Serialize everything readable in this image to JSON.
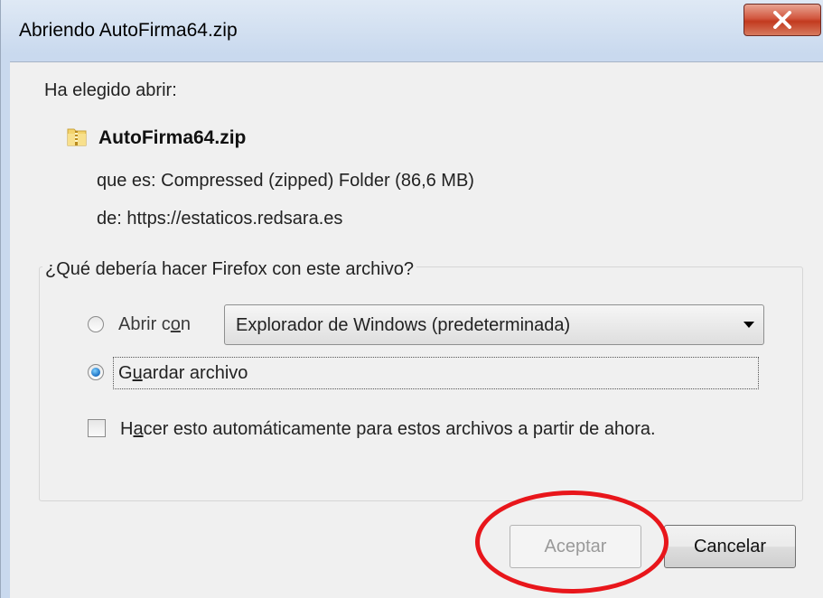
{
  "window": {
    "title": "Abriendo AutoFirma64.zip",
    "close_glyph": "X"
  },
  "info": {
    "chosen_label": "Ha elegido abrir:",
    "file_icon": "zip-folder-icon",
    "filename": "AutoFirma64.zip",
    "type_line": "que es: Compressed (zipped) Folder (86,6 MB)",
    "from_label": "de:",
    "from_value": "https://estaticos.redsara.es"
  },
  "action_group": {
    "legend": "¿Qué debería hacer Firefox con este archivo?",
    "open_with": {
      "pre": "Abrir c",
      "accel": "o",
      "post": "n",
      "checked": false
    },
    "open_with_select": "Explorador de Windows (predeterminada)",
    "save": {
      "pre": "G",
      "accel": "u",
      "post": "ardar archivo",
      "checked": true
    },
    "auto": {
      "pre": "H",
      "accel": "a",
      "post": "cer esto automáticamente para estos archivos a partir de ahora.",
      "checked": false
    }
  },
  "buttons": {
    "ok": "Aceptar",
    "cancel": "Cancelar"
  },
  "colors": {
    "annotation": "#e8161b",
    "close_button": "#c23a1f"
  }
}
